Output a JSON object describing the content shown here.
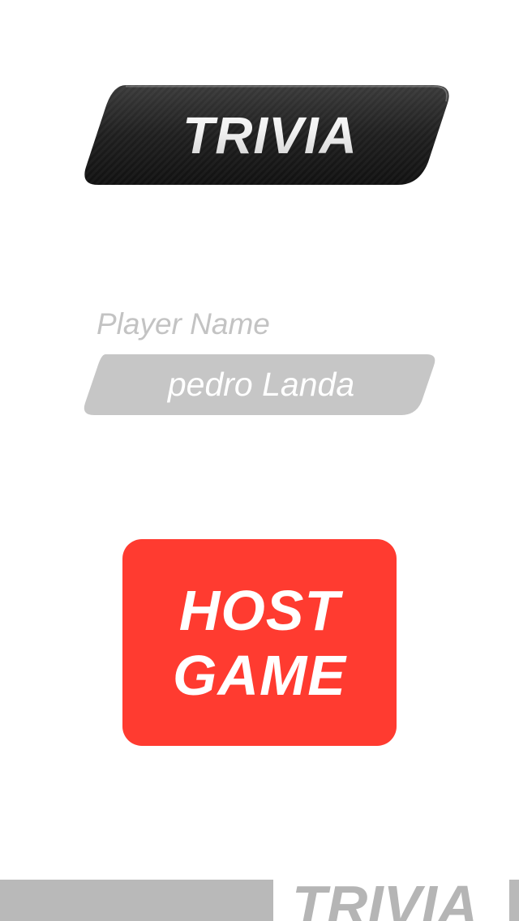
{
  "header": {
    "logo_text": "TRIVIA"
  },
  "player": {
    "label": "Player Name",
    "name_value": "pedro Landa"
  },
  "host_button": {
    "line1": "HOST",
    "line2": "GAME"
  },
  "footer": {
    "logo_text": "TRIVIA"
  },
  "colors": {
    "background": "#ffffff",
    "logo_banner": "#1e1e1e",
    "label_text": "#c3c3c3",
    "field_fill": "#c6c6c6",
    "host_button": "#ff3b30",
    "footer_gray": "#b9b9b9"
  }
}
